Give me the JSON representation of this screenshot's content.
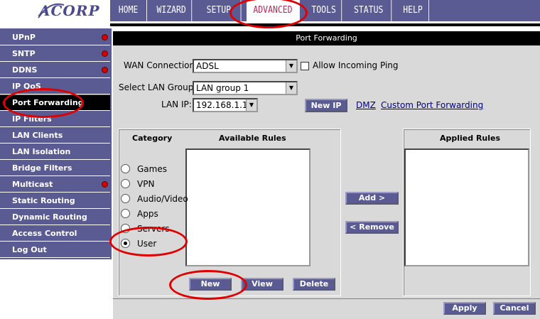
{
  "brand": {
    "logo_text": "ACORP"
  },
  "nav": {
    "items": [
      {
        "label": "HOME"
      },
      {
        "label": "WIZARD"
      },
      {
        "label": "SETUP"
      },
      {
        "label": "ADVANCED"
      },
      {
        "label": "TOOLS"
      },
      {
        "label": "STATUS"
      },
      {
        "label": "HELP"
      }
    ],
    "active": "ADVANCED"
  },
  "sidebar": {
    "items": [
      {
        "label": "UPnP"
      },
      {
        "label": "SNTP"
      },
      {
        "label": "DDNS"
      },
      {
        "label": "IP QoS"
      },
      {
        "label": "Port Forwarding"
      },
      {
        "label": "IP Filters"
      },
      {
        "label": "LAN Clients"
      },
      {
        "label": "LAN Isolation"
      },
      {
        "label": "Bridge Filters"
      },
      {
        "label": "Multicast"
      },
      {
        "label": "Static Routing"
      },
      {
        "label": "Dynamic Routing"
      },
      {
        "label": "Access Control"
      },
      {
        "label": "Log Out"
      }
    ],
    "active": "Port Forwarding"
  },
  "page": {
    "title": "Port Forwarding"
  },
  "form": {
    "wan_label": "WAN Connection:",
    "wan_value": "ADSL",
    "ping_label": "Allow Incoming Ping",
    "lan_group_label": "Select LAN Group:",
    "lan_group_value": "LAN group 1",
    "lan_ip_label": "LAN IP:",
    "lan_ip_value": "192.168.1.1",
    "new_ip_button": "New IP",
    "dmz_link": "DMZ",
    "custom_link": "Custom Port Forwarding"
  },
  "rules": {
    "category_header": "Category",
    "available_header": "Available Rules",
    "applied_header": "Applied Rules",
    "categories": [
      {
        "label": "Games"
      },
      {
        "label": "VPN"
      },
      {
        "label": "Audio/Video"
      },
      {
        "label": "Apps"
      },
      {
        "label": "Servers"
      },
      {
        "label": "User"
      }
    ],
    "selected_category": "User",
    "add_button": "Add >",
    "remove_button": "< Remove",
    "new_button": "New",
    "view_button": "View",
    "delete_button": "Delete"
  },
  "footer": {
    "apply_button": "Apply",
    "cancel_button": "Cancel"
  },
  "colors": {
    "nav_bg": "#5b5b93",
    "active_tab_text": "#b22a5a",
    "highlight_ring": "#e00000",
    "panel_bg": "#d9d9d9"
  }
}
